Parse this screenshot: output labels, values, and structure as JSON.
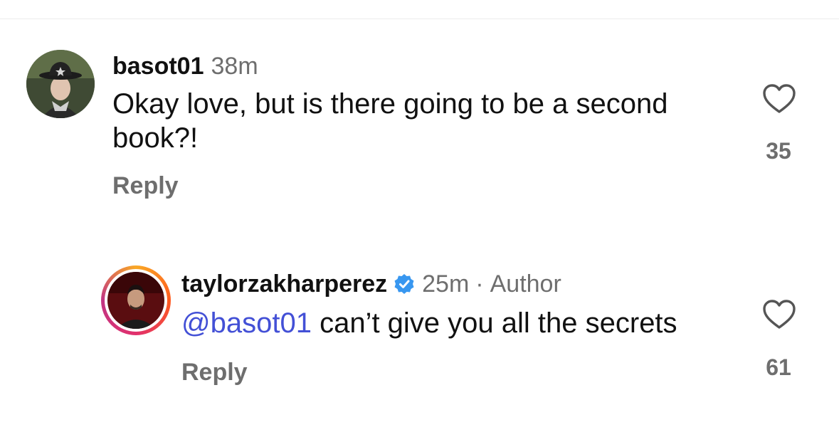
{
  "comments": [
    {
      "username": "basot01",
      "time": "38m",
      "text": "Okay love, but is there going to be a second book?!",
      "reply_label": "Reply",
      "likes": "35",
      "avatar_icon": "user-avatar-cowboy-hat"
    },
    {
      "username": "taylorzakharperez",
      "verified": true,
      "time": "25m",
      "separator": "·",
      "author_label": "Author",
      "mention": "@basot01",
      "text": " can’t give you all the secrets",
      "reply_label": "Reply",
      "likes": "61",
      "avatar_icon": "user-avatar-story-ring"
    }
  ],
  "colors": {
    "mention": "#4350d6",
    "secondary_text": "#6e6e6e",
    "verified_badge": "#3897f0",
    "story_ring": [
      "#f9a825",
      "#ff5a1f",
      "#e1306c",
      "#c13584"
    ]
  }
}
